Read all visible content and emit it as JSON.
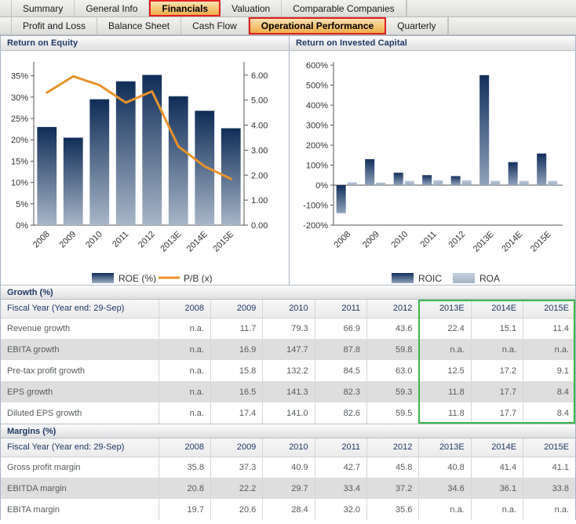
{
  "tabs_primary": [
    {
      "label": "Summary",
      "active": false
    },
    {
      "label": "General Info",
      "active": false
    },
    {
      "label": "Financials",
      "active": true
    },
    {
      "label": "Valuation",
      "active": false
    },
    {
      "label": "Comparable Companies",
      "active": false
    }
  ],
  "tabs_secondary": [
    {
      "label": "Profit and Loss",
      "active": false
    },
    {
      "label": "Balance Sheet",
      "active": false
    },
    {
      "label": "Cash Flow",
      "active": false
    },
    {
      "label": "Operational Performance",
      "active": true
    },
    {
      "label": "Quarterly",
      "active": false
    }
  ],
  "panels": {
    "roe_title": "Return on Equity",
    "roic_title": "Return on Invested Capital"
  },
  "colors": {
    "bar_dark": "#12305c",
    "bar_light": "#9aabc2",
    "line_orange": "#e8922a",
    "accent_red": "#e02020",
    "accent_green": "#3cb54a",
    "tab_active_fill": "#f3c478",
    "title_navy": "#1f3864"
  },
  "chart_data": [
    {
      "type": "bar",
      "title": "Return on Equity",
      "categories": [
        "2008",
        "2009",
        "2010",
        "2011",
        "2012",
        "2013E",
        "2014E",
        "2015E"
      ],
      "xlabel": "",
      "ylabel": "",
      "ylim": [
        0,
        37.5
      ],
      "y_ticks": [
        "0%",
        "5%",
        "10%",
        "15%",
        "20%",
        "25%",
        "30%",
        "35%"
      ],
      "y2lim": [
        0,
        6.4
      ],
      "y2_ticks": [
        "0.00",
        "1.00",
        "2.00",
        "3.00",
        "4.00",
        "5.00",
        "6.00"
      ],
      "grid": false,
      "legend_position": "bottom",
      "series": [
        {
          "name": "ROE (%)",
          "kind": "bar",
          "axis": "left",
          "values": [
            23.0,
            20.5,
            29.5,
            33.7,
            35.2,
            30.2,
            26.8,
            22.7
          ]
        },
        {
          "name": "P/B (x)",
          "kind": "line",
          "axis": "right",
          "values": [
            5.3,
            5.95,
            5.6,
            4.9,
            5.35,
            3.15,
            2.35,
            1.85
          ]
        }
      ]
    },
    {
      "type": "bar",
      "title": "Return on Invested Capital",
      "categories": [
        "2008",
        "2009",
        "2010",
        "2011",
        "2012",
        "2013E",
        "2014E",
        "2015E"
      ],
      "xlabel": "",
      "ylabel": "",
      "ylim": [
        -200,
        600
      ],
      "y_ticks": [
        "-200%",
        "-100%",
        "0%",
        "100%",
        "200%",
        "300%",
        "400%",
        "500%",
        "600%"
      ],
      "grid": false,
      "legend_position": "bottom",
      "series": [
        {
          "name": "ROIC",
          "kind": "bar",
          "values": [
            -140,
            130,
            62,
            50,
            45,
            550,
            115,
            158
          ]
        },
        {
          "name": "ROA",
          "kind": "bar",
          "values": [
            14,
            13,
            21,
            24,
            24,
            21,
            21,
            21
          ]
        }
      ]
    }
  ],
  "growth": {
    "section_title": "Growth (%)",
    "headers": [
      "Fiscal Year (Year end: 29-Sep)",
      "2008",
      "2009",
      "2010",
      "2011",
      "2012",
      "2013E",
      "2014E",
      "2015E"
    ],
    "rows": [
      {
        "label": "Revenue growth",
        "values": [
          "n.a.",
          "11.7",
          "79.3",
          "66.9",
          "43.6",
          "22.4",
          "15.1",
          "11.4"
        ]
      },
      {
        "label": "EBITA growth",
        "values": [
          "n.a.",
          "16.9",
          "147.7",
          "87.8",
          "59.8",
          "n.a.",
          "n.a.",
          "n.a."
        ]
      },
      {
        "label": "Pre-tax profit growth",
        "values": [
          "n.a.",
          "15.8",
          "132.2",
          "84.5",
          "63.0",
          "12.5",
          "17.2",
          "9.1"
        ]
      },
      {
        "label": "EPS growth",
        "values": [
          "n.a.",
          "16.5",
          "141.3",
          "82.3",
          "59.3",
          "11.8",
          "17.7",
          "8.4"
        ]
      },
      {
        "label": "Diluted EPS growth",
        "values": [
          "n.a.",
          "17.4",
          "141.0",
          "82.6",
          "59.5",
          "11.8",
          "17.7",
          "8.4"
        ]
      }
    ]
  },
  "margins": {
    "section_title": "Margins (%)",
    "headers": [
      "Fiscal Year (Year end: 29-Sep)",
      "2008",
      "2009",
      "2010",
      "2011",
      "2012",
      "2013E",
      "2014E",
      "2015E"
    ],
    "rows": [
      {
        "label": "Gross profit margin",
        "values": [
          "35.8",
          "37.3",
          "40.9",
          "42.7",
          "45.8",
          "40.8",
          "41.4",
          "41.1"
        ]
      },
      {
        "label": "EBITDA margin",
        "values": [
          "20.8",
          "22.2",
          "29.7",
          "33.4",
          "37.2",
          "34.6",
          "36.1",
          "33.8"
        ]
      },
      {
        "label": "EBITA margin",
        "values": [
          "19.7",
          "20.6",
          "28.4",
          "32.0",
          "35.6",
          "n.a.",
          "n.a.",
          "n.a."
        ]
      }
    ]
  }
}
